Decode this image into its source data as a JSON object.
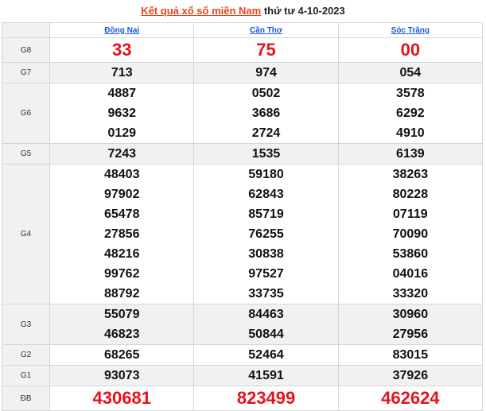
{
  "header": {
    "title_link": "Kết quả xổ số miền Nam",
    "title_date": "thứ tư 4-10-2023"
  },
  "provinces": [
    "Đồng Nai",
    "Cần Thơ",
    "Sóc Trăng"
  ],
  "prizes": [
    {
      "label": "G8",
      "values": [
        [
          "33"
        ],
        [
          "75"
        ],
        [
          "00"
        ]
      ]
    },
    {
      "label": "G7",
      "values": [
        [
          "713"
        ],
        [
          "974"
        ],
        [
          "054"
        ]
      ]
    },
    {
      "label": "G6",
      "values": [
        [
          "4887",
          "9632",
          "0129"
        ],
        [
          "0502",
          "3686",
          "2724"
        ],
        [
          "3578",
          "6292",
          "4910"
        ]
      ]
    },
    {
      "label": "G5",
      "values": [
        [
          "7243"
        ],
        [
          "1535"
        ],
        [
          "6139"
        ]
      ]
    },
    {
      "label": "G4",
      "values": [
        [
          "48403",
          "97902",
          "65478",
          "27856",
          "48216",
          "99762",
          "88792"
        ],
        [
          "59180",
          "62843",
          "85719",
          "76255",
          "30838",
          "97527",
          "33735"
        ],
        [
          "38263",
          "80228",
          "07119",
          "70090",
          "53860",
          "04016",
          "33320"
        ]
      ]
    },
    {
      "label": "G3",
      "values": [
        [
          "55079",
          "46823"
        ],
        [
          "84463",
          "50844"
        ],
        [
          "30960",
          "27956"
        ]
      ]
    },
    {
      "label": "G2",
      "values": [
        [
          "68265"
        ],
        [
          "52464"
        ],
        [
          "83015"
        ]
      ]
    },
    {
      "label": "G1",
      "values": [
        [
          "93073"
        ],
        [
          "41591"
        ],
        [
          "37926"
        ]
      ]
    },
    {
      "label": "ĐB",
      "values": [
        [
          "430681"
        ],
        [
          "823499"
        ],
        [
          "462624"
        ]
      ]
    }
  ],
  "colors": {
    "accent_red": "#e8121a",
    "link_orange": "#e8431a",
    "link_blue": "#1a56d6",
    "alt_row": "#f1f1f1"
  }
}
